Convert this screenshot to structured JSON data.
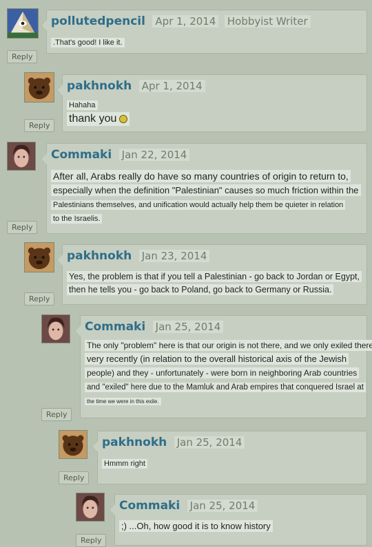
{
  "reply_label": "Reply",
  "comments": [
    {
      "user": "pollutedpencil",
      "date": "Apr 1, 2014",
      "rank": "Hobbyist Writer",
      "lines": [
        ".That's good! I like it."
      ]
    },
    {
      "user": "pakhnokh",
      "date": "Apr 1, 2014",
      "lines": [
        "Hahaha",
        "thank you"
      ]
    },
    {
      "user": "Commaki",
      "date": "Jan 22, 2014",
      "lines": [
        "After all, Arabs really do have so many countries of origin to return to,",
        "especially when the definition \"Palestinian\" causes so much friction within the",
        "Palestinians themselves, and unification would actually help them be quieter in relation",
        "to the Israelis."
      ]
    },
    {
      "user": "pakhnokh",
      "date": "Jan 23, 2014",
      "lines": [
        "Yes, the problem is that if you tell a Palestinian - go back to Jordan or Egypt,",
        "then he tells you - go back to Poland, go back to Germany or Russia."
      ]
    },
    {
      "user": "Commaki",
      "date": "Jan 25, 2014",
      "lines": [
        "The only \"problem\" here is that our origin is not there, and we only exiled there",
        "very recently (in relation to the overall historical axis of the Jewish",
        "people) and they - unfortunately - were born in neighboring Arab countries",
        "and \"exiled\" here due to the Mamluk and Arab empires that conquered Israel at",
        "the time we were in this exile."
      ]
    },
    {
      "user": "pakhnokh",
      "date": "Jan 25, 2014",
      "lines": [
        "Hmmm right"
      ]
    },
    {
      "user": "Commaki",
      "date": "Jan 25, 2014",
      "lines": [
        ";) ...Oh, how good it is to know history"
      ]
    }
  ]
}
